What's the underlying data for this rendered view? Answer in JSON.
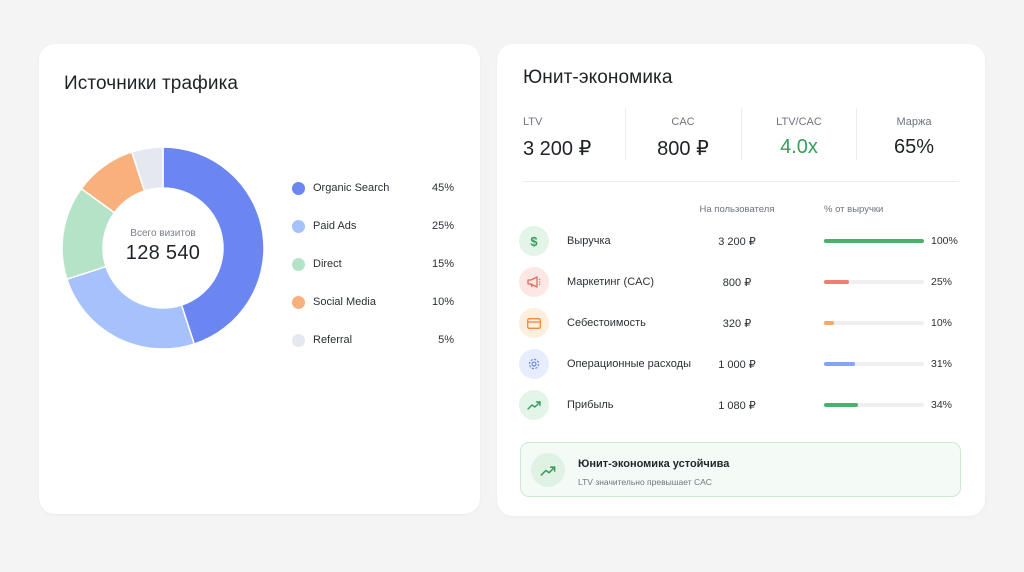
{
  "traffic": {
    "title": "Источники трафика",
    "center_label": "Всего визитов",
    "center_value": "128 540",
    "sources": [
      {
        "label": "Organic Search",
        "value": "45%",
        "share": 45,
        "color": "#6b86f0"
      },
      {
        "label": "Paid Ads",
        "value": "25%",
        "share": 25,
        "color": "#a6c1fb"
      },
      {
        "label": "Direct",
        "value": "15%",
        "share": 15,
        "color": "#b5e3c8"
      },
      {
        "label": "Social Media",
        "value": "10%",
        "share": 10,
        "color": "#f8b07c"
      },
      {
        "label": "Referral",
        "value": "5%",
        "share": 5,
        "color": "#e6e8ef"
      }
    ]
  },
  "unit": {
    "title": "Юнит-экономика",
    "kpis": [
      {
        "label": "LTV",
        "value": "3 200 ₽",
        "color": "#1f2328"
      },
      {
        "label": "CAC",
        "value": "800 ₽",
        "color": "#1f2328"
      },
      {
        "label": "LTV/CAC",
        "value": "4.0x",
        "color": "#3a9c5a"
      },
      {
        "label": "Маржа",
        "value": "65%",
        "color": "#1f2328"
      }
    ],
    "headers": {
      "per_user": "На пользователя",
      "pct_revenue": "% от выручки"
    },
    "rows": [
      {
        "name": "Выручка",
        "value": "3 200 ₽",
        "pct": "100%",
        "fill": 1.0,
        "icon": "dollar-icon",
        "glyph": "$",
        "icon_color": "#3a9c5a",
        "icon_bg": "#e3f4e8",
        "bar_color": "#4caf6a"
      },
      {
        "name": "Маркетинг (CAC)",
        "value": "800 ₽",
        "pct": "25%",
        "fill": 0.25,
        "icon": "megaphone-icon",
        "glyph": "📢",
        "icon_color": "#e06a5f",
        "icon_bg": "#fde7e4",
        "bar_color": "#f07d70"
      },
      {
        "name": "Себестоимость",
        "value": "320 ₽",
        "pct": "10%",
        "fill": 0.1,
        "icon": "card-icon",
        "glyph": "▭",
        "icon_color": "#f0883e",
        "icon_bg": "#fdeede",
        "bar_color": "#f7a85e"
      },
      {
        "name": "Операционные расходы",
        "value": "1 000 ₽",
        "pct": "31%",
        "fill": 0.31,
        "icon": "gear-icon",
        "glyph": "⚙",
        "icon_color": "#6b86f0",
        "icon_bg": "#e8edfd",
        "bar_color": "#86a4f4"
      },
      {
        "name": "Прибыль",
        "value": "1 080 ₽",
        "pct": "34%",
        "fill": 0.34,
        "icon": "trend-up-icon",
        "glyph": "↗",
        "icon_color": "#3a9c5a",
        "icon_bg": "#e3f4e8",
        "bar_color": "#4caf6a"
      }
    ],
    "status": {
      "title": "Юнит-экономика устойчива",
      "subtitle": "LTV значительно превышает CAC",
      "icon": "trend-up-icon",
      "color": "#3a9c5a"
    }
  }
}
